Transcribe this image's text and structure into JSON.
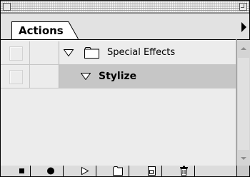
{
  "palette": {
    "tab_label": "Actions"
  },
  "actions": [
    {
      "label": "Special Effects",
      "kind": "set",
      "icon": "folder-icon",
      "expanded": true,
      "enabled": false
    },
    {
      "label": "Stylize",
      "kind": "action",
      "expanded": true,
      "selected": true,
      "enabled": false
    }
  ],
  "toolbar": {
    "buttons": [
      {
        "name": "stop-button",
        "icon": "stop-icon"
      },
      {
        "name": "record-button",
        "icon": "record-icon"
      },
      {
        "name": "play-button",
        "icon": "play-icon"
      },
      {
        "name": "new-set-button",
        "icon": "folder-icon"
      },
      {
        "name": "new-action-button",
        "icon": "new-page-icon"
      },
      {
        "name": "delete-button",
        "icon": "trash-icon"
      }
    ]
  },
  "colors": {
    "selected_row": "#c6c6c6",
    "list_background": "#ececec",
    "chrome": "#dcdcdc"
  }
}
